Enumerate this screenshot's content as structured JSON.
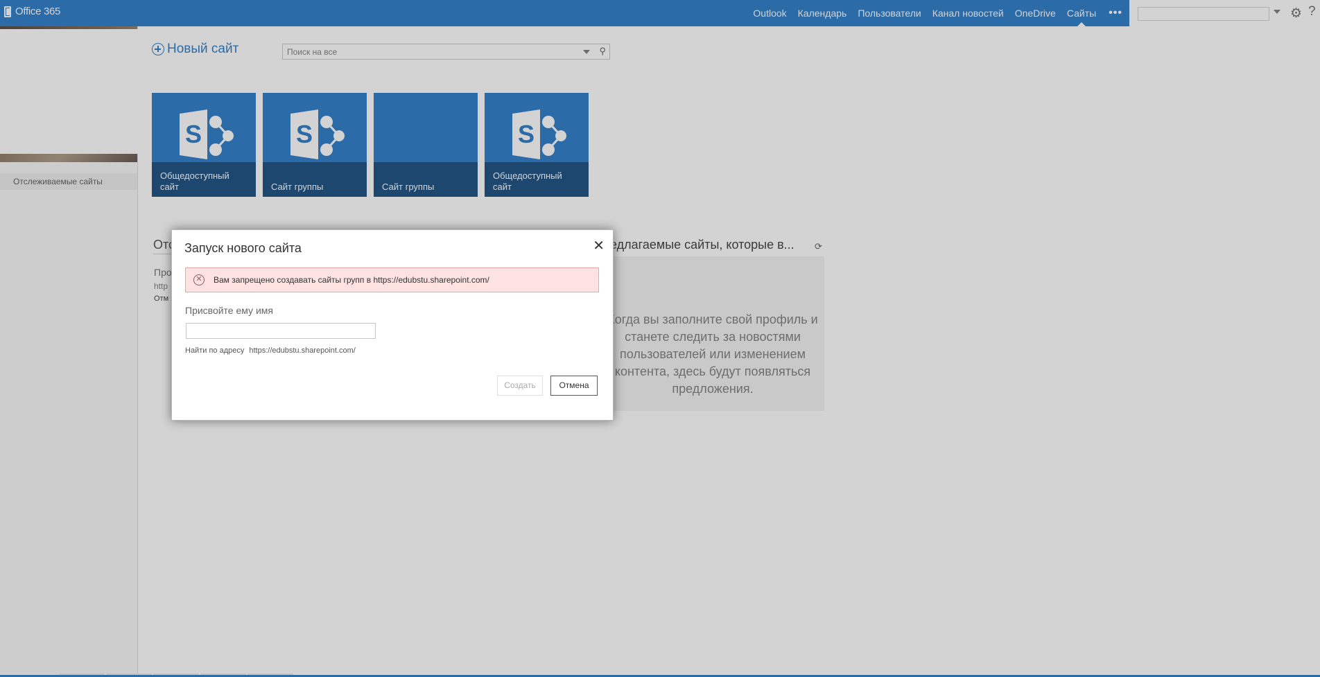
{
  "topbar": {
    "brand": "Office 365",
    "nav": [
      "Outlook",
      "Календарь",
      "Пользователи",
      "Канал новостей",
      "OneDrive",
      "Сайты"
    ],
    "active_nav": "Сайты",
    "more": "•••",
    "accent_color": "#1e74c6"
  },
  "leftnav": {
    "items": [
      {
        "label": "Отслеживаемые сайты"
      }
    ]
  },
  "main": {
    "new_site_label": "Новый сайт",
    "search_placeholder": "Поиск на все",
    "tiles": [
      {
        "label": "Общедоступный сайт",
        "icon": "sharepoint-icon"
      },
      {
        "label": "Сайт группы",
        "icon": "sharepoint-icon"
      },
      {
        "label": "Сайт группы",
        "icon": "none"
      },
      {
        "label": "Общедоступный сайт",
        "icon": "sharepoint-icon"
      }
    ],
    "followed_heading": "Отс",
    "followed_line1": "Про",
    "followed_line2": "http",
    "followed_line3": "Отм",
    "suggested_heading": "редлагаемые сайты, которые в...",
    "suggested_text": "Когда вы заполните свой профиль и станете следить за новостями пользователей или изменением контента, здесь будут появляться предложения."
  },
  "dialog": {
    "title": "Запуск нового сайта",
    "error": "Вам запрещено создавать сайты групп в https://edubstu.sharepoint.com/",
    "name_label": "Присвойте ему имя",
    "name_value": "",
    "address_label": "Найти по адресу",
    "address_value": "https://edubstu.sharepoint.com/",
    "create_label": "Создать",
    "cancel_label": "Отмена",
    "close_glyph": "✕"
  }
}
